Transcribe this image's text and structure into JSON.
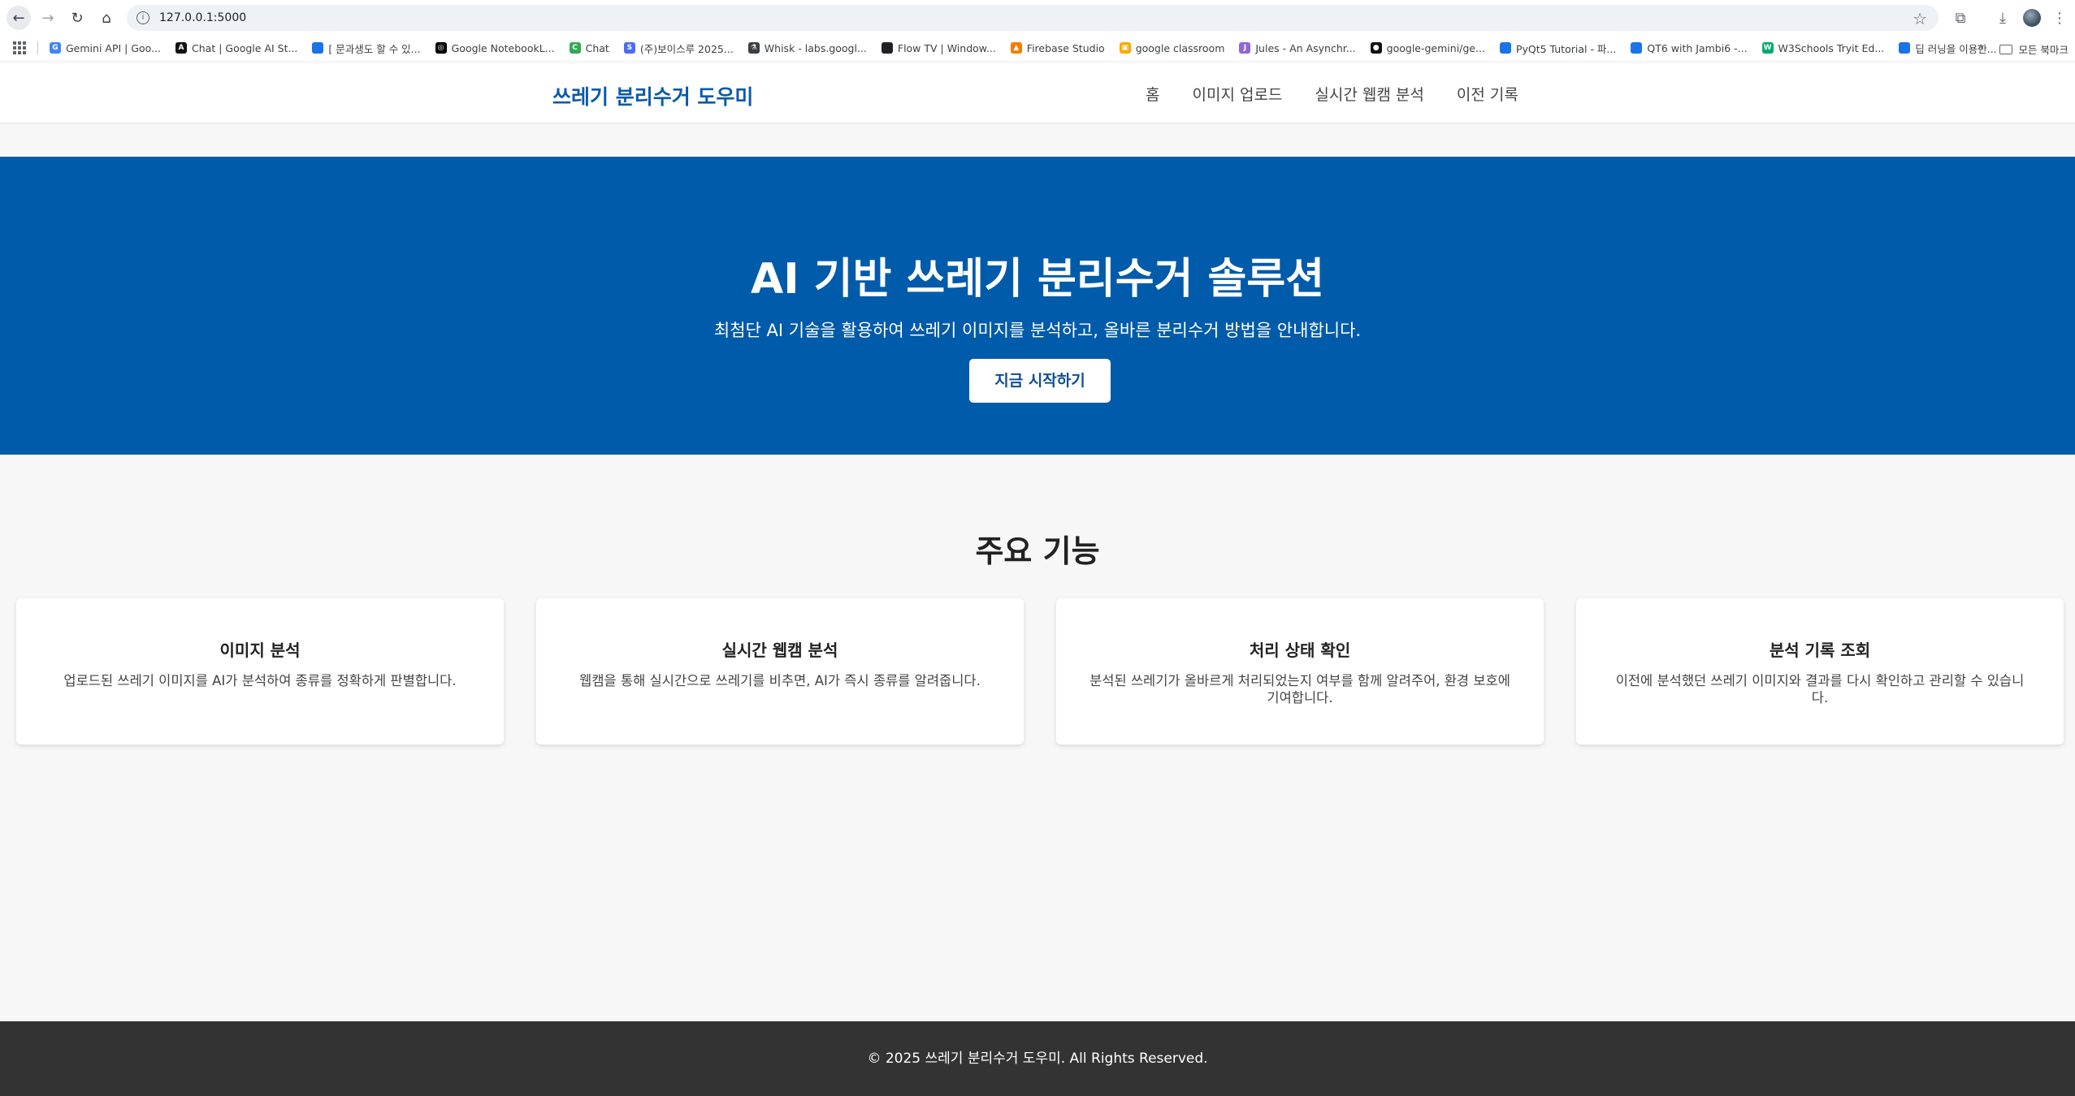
{
  "browser": {
    "url": "127.0.0.1:5000",
    "bookmarks": [
      {
        "label": "Gemini API  |  Goo...",
        "icon": "google-icon",
        "color": "#4285f4",
        "glyph": "G"
      },
      {
        "label": "Chat | Google AI St...",
        "icon": "ai-studio-icon",
        "color": "#111111",
        "glyph": "A"
      },
      {
        "label": "[ 문과생도 할 수 있...",
        "icon": "bookmark-blue-icon",
        "color": "#1a73e8",
        "glyph": ""
      },
      {
        "label": "Google NotebookL...",
        "icon": "notebooklm-icon",
        "color": "#000000",
        "glyph": "◎"
      },
      {
        "label": "Chat",
        "icon": "chat-icon",
        "color": "#34a853",
        "glyph": "C"
      },
      {
        "label": "(주)보이스루 2025...",
        "icon": "s-icon",
        "color": "#4a6cf7",
        "glyph": "S"
      },
      {
        "label": "Whisk - labs.googl...",
        "icon": "flask-icon",
        "color": "#3c4043",
        "glyph": "⚗"
      },
      {
        "label": "Flow TV | Window...",
        "icon": "folder-dark-icon",
        "color": "#202124",
        "glyph": ""
      },
      {
        "label": "Firebase Studio",
        "icon": "firebase-icon",
        "color": "#f57c00",
        "glyph": "▲"
      },
      {
        "label": "google classroom",
        "icon": "classroom-icon",
        "color": "#f9ab00",
        "glyph": "▣"
      },
      {
        "label": "Jules - An Asynchr...",
        "icon": "jules-icon",
        "color": "#8e67d8",
        "glyph": "J"
      },
      {
        "label": "google-gemini/ge...",
        "icon": "github-icon",
        "color": "#111111",
        "glyph": "●"
      },
      {
        "label": "PyQt5 Tutorial - 파...",
        "icon": "bookmark-blue-icon",
        "color": "#1a73e8",
        "glyph": ""
      },
      {
        "label": "QT6 with Jambi6 -...",
        "icon": "bookmark-blue-icon",
        "color": "#1a73e8",
        "glyph": ""
      },
      {
        "label": "W3Schools Tryit Ed...",
        "icon": "w3schools-icon",
        "color": "#04aa6d",
        "glyph": "W"
      },
      {
        "label": "딥 러닝을 이용한...",
        "icon": "bookmark-blue-icon",
        "color": "#1a73e8",
        "glyph": ""
      }
    ],
    "all_bookmarks_label": "모든 북마크"
  },
  "site": {
    "brand": "쓰레기 분리수거 도우미",
    "nav": [
      "홈",
      "이미지 업로드",
      "실시간 웹캠 분석",
      "이전 기록"
    ]
  },
  "hero": {
    "title": "AI 기반 쓰레기 분리수거 솔루션",
    "subtitle": "최첨단 AI 기술을 활용하여 쓰레기 이미지를 분석하고, 올바른 분리수거 방법을 안내합니다.",
    "cta_label": "지금 시작하기"
  },
  "features": {
    "title": "주요 기능",
    "cards": [
      {
        "title": "이미지 분석",
        "desc": "업로드된 쓰레기 이미지를 AI가 분석하여 종류를 정확하게 판별합니다."
      },
      {
        "title": "실시간 웹캠 분석",
        "desc": "웹캠을 통해 실시간으로 쓰레기를 비추면, AI가 즉시 종류를 알려줍니다."
      },
      {
        "title": "처리 상태 확인",
        "desc": "분석된 쓰레기가 올바르게 처리되었는지 여부를 함께 알려주어, 환경 보호에 기여합니다."
      },
      {
        "title": "분석 기록 조회",
        "desc": "이전에 분석했던 쓰레기 이미지와 결과를 다시 확인하고 관리할 수 있습니다."
      }
    ]
  },
  "footer": {
    "text": "© 2025 쓰레기 분리수거 도우미. All Rights Reserved."
  },
  "colors": {
    "brand": "#0d5aa7",
    "hero_bg": "#005baa",
    "footer_bg": "#333333",
    "page_bg": "#f7f7f7"
  }
}
